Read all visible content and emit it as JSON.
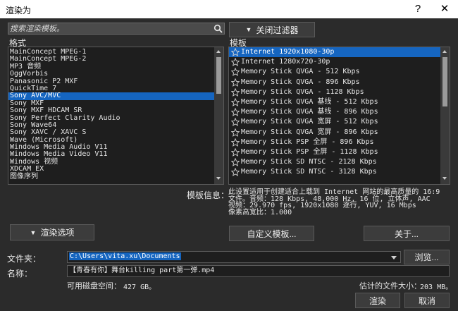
{
  "window": {
    "title": "渲染为"
  },
  "titlebar": {
    "help": "?",
    "close": "✕"
  },
  "search": {
    "placeholder": "搜索渲染模板。"
  },
  "filter_button": {
    "label": "关闭过滤器"
  },
  "format": {
    "label": "格式",
    "items": [
      "MainConcept MPEG-1",
      "MainConcept MPEG-2",
      "MP3 音频",
      "OggVorbis",
      "Panasonic P2 MXF",
      "QuickTime 7",
      "Sony AVC/MVC",
      "Sony MXF",
      "Sony MXF HDCAM SR",
      "Sony Perfect Clarity Audio",
      "Sony Wave64",
      "Sony XAVC / XAVC S",
      "Wave (Microsoft)",
      "Windows Media Audio V11",
      "Windows Media Video V11",
      "Windows 视频",
      "XDCAM EX",
      "图像序列"
    ],
    "selected_index": 6
  },
  "template": {
    "label": "模板",
    "items": [
      "Internet 1920x1080-30p",
      "Internet 1280x720-30p",
      "Memory Stick QVGA - 512 Kbps",
      "Memory Stick QVGA - 896 Kbps",
      "Memory Stick QVGA - 1128 Kbps",
      "Memory Stick QVGA 基线 - 512 Kbps",
      "Memory Stick QVGA 基线 - 896 Kbps",
      "Memory Stick QVGA 宽屏 - 512 Kbps",
      "Memory Stick QVGA 宽屏 - 896 Kbps",
      "Memory Stick PSP 全屏 - 896 Kbps",
      "Memory Stick PSP 全屏 - 1128 Kbps",
      "Memory Stick SD NTSC - 2128 Kbps",
      "Memory Stick SD NTSC - 3128 Kbps"
    ],
    "selected_index": 0
  },
  "template_info": {
    "label": "模板信息：",
    "lines": [
      "此设置适用于创建适合上载到 Internet 网站的最高质量的 16:9",
      "文件。音频：128 Kbps, 48,000 Hz, 16 位, 立体声, AAC",
      "视频：29.970 fps, 1920x1080 逐行, YUV, 16 Mbps",
      "像素高宽比：1.000"
    ]
  },
  "render_options_button": {
    "label": "渲染选项"
  },
  "custom_template_button": {
    "label": "自定义模板..."
  },
  "about_button": {
    "label": "关于..."
  },
  "folder": {
    "label": "文件夹：",
    "value": "C:\\Users\\vita.xu\\Documents"
  },
  "browse_button": {
    "label": "浏览..."
  },
  "name": {
    "label": "名称：",
    "value": "【青春有你】舞台killing part第一弹.mp4"
  },
  "disk": {
    "label": "可用磁盘空间：",
    "value": "427 GB。"
  },
  "estimate": {
    "label": "估计的文件大小：",
    "value": "203 MB。"
  },
  "render_button": {
    "label": "渲染"
  },
  "cancel_button": {
    "label": "取消"
  },
  "colors": {
    "background": "#2b2b2b",
    "selection": "#1565c0",
    "list_bg": "#1e1e1e"
  }
}
